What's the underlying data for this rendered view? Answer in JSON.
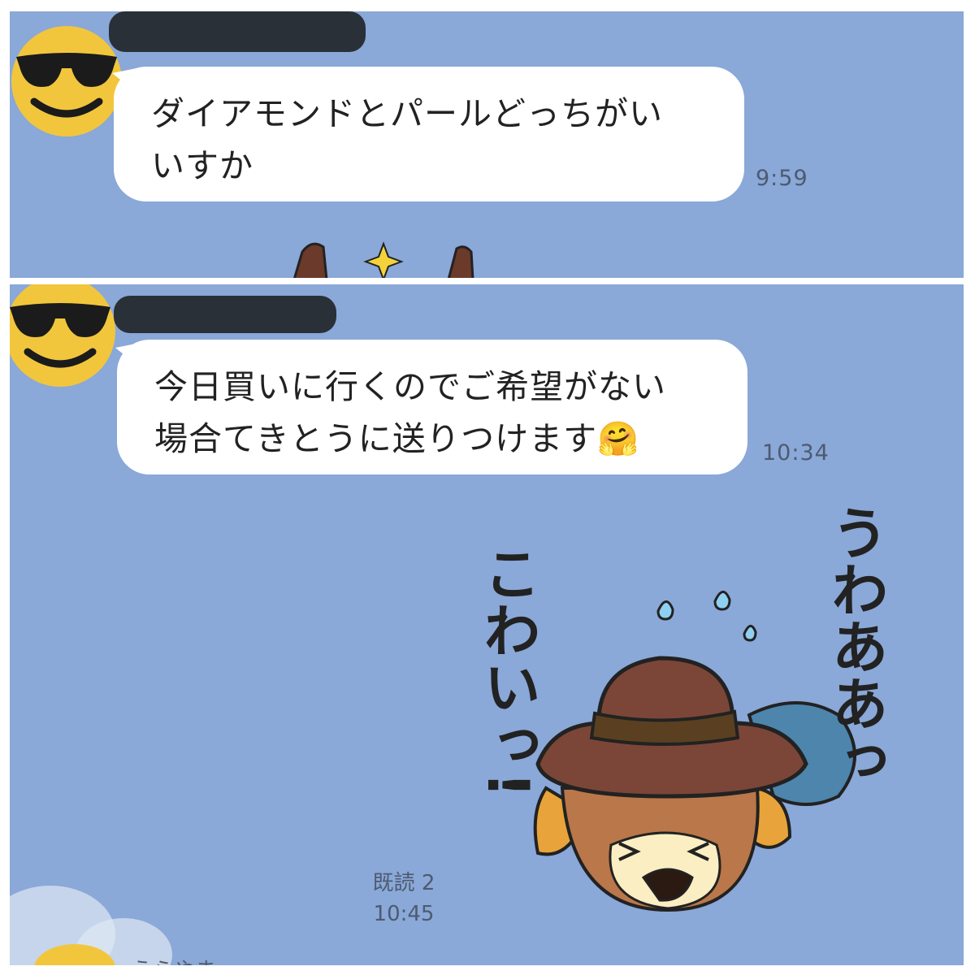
{
  "top": {
    "message": {
      "line1": "ダイアモンドとパールどっちがい",
      "line2": "いすか",
      "time": "9:59"
    }
  },
  "bottom": {
    "message": {
      "line1": "今日買いに行くのでご希望がない",
      "line2": "場合てきとうに送りつけます",
      "emoji": "🤗",
      "time": "10:34"
    },
    "sticker": {
      "text_right": "うわああっ",
      "text_left": "こわいっ!"
    },
    "reply": {
      "read": "既読 2",
      "time": "10:45"
    },
    "next_preview": "うらやま"
  },
  "colors": {
    "chat_bg": "#8aa8d8",
    "bubble": "#ffffff",
    "time_text": "#4d5b70"
  },
  "icons": {
    "avatar": "sunglasses-face-icon"
  }
}
